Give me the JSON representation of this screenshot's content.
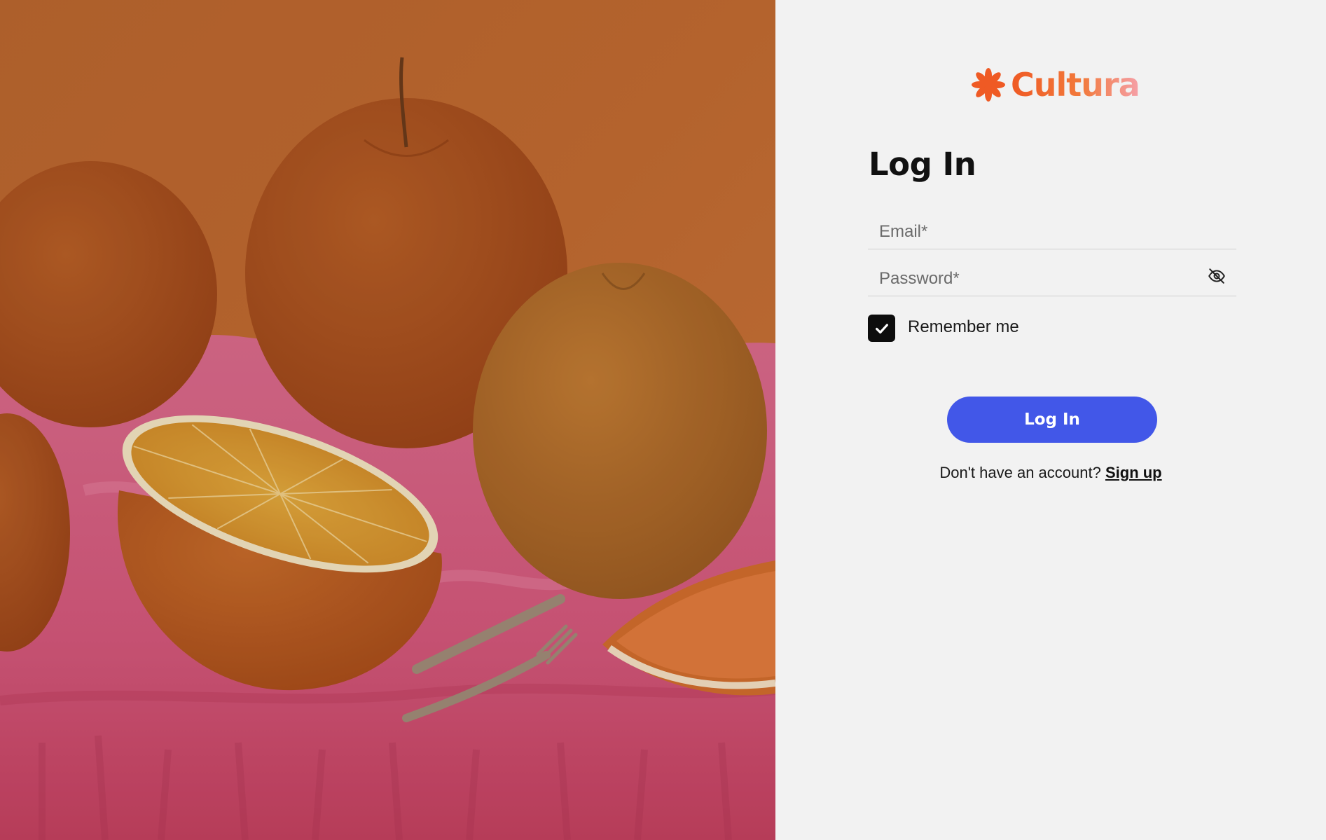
{
  "brand": {
    "name": "Cultura",
    "logo_icon": "asterisk-flower-icon",
    "colors": {
      "primary": "#ef5a24",
      "gradient_end": "#f5a0a8"
    }
  },
  "artwork": {
    "subject": "still-life-oranges-painting"
  },
  "login": {
    "title": "Log In",
    "email_placeholder": "Email*",
    "password_placeholder": "Password*",
    "password_toggle_icon": "eye-off-icon",
    "remember_label": "Remember me",
    "remember_checked": true,
    "submit_label": "Log In",
    "submit_color": "#4257e8",
    "signup_prompt": "Don't have an account?",
    "signup_link": "Sign up"
  }
}
